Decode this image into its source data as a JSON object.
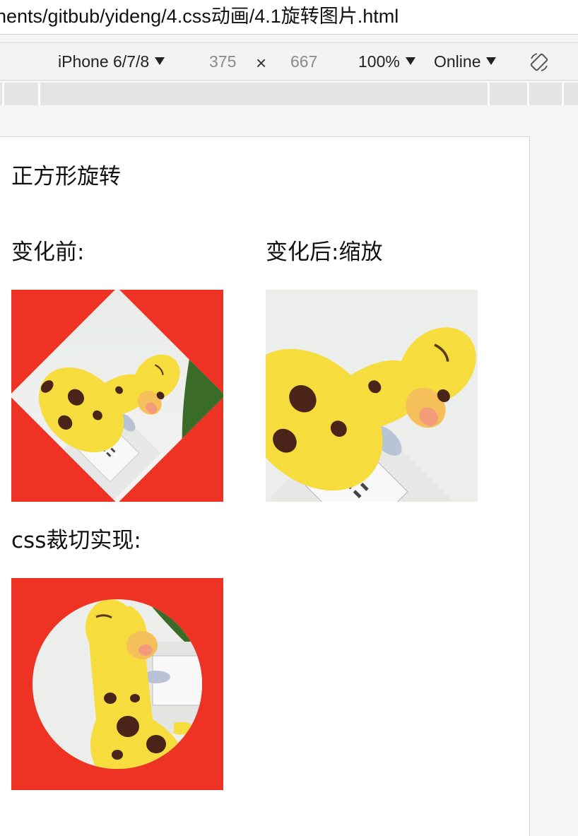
{
  "address_bar": {
    "url_text": "nents/gitbub/yideng/4.css动画/4.1旋转图片.html"
  },
  "device_toolbar": {
    "device": "iPhone 6/7/8",
    "width": "375",
    "times": "×",
    "height": "667",
    "zoom": "100%",
    "network": "Online",
    "rotate_icon": "rotate-device-icon"
  },
  "page": {
    "heading": "正方形旋转",
    "before_label": "变化前:",
    "after_label": "变化后:缩放",
    "clip_label": "css裁切实现:",
    "images": {
      "subject": "yellow plush giraffe toy",
      "accent_background": "#ee3324"
    }
  },
  "colors": {
    "red": "#ee3324",
    "giraffe_yellow": "#f6dc3c",
    "spot_brown": "#4a2418"
  }
}
